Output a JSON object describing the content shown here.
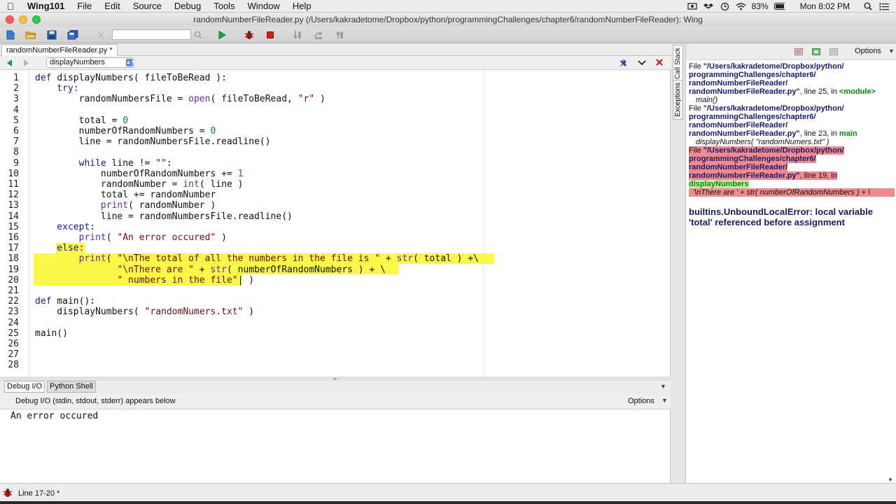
{
  "menubar": {
    "app_name": "Wing101",
    "items": [
      "File",
      "Edit",
      "Source",
      "Debug",
      "Tools",
      "Window",
      "Help"
    ],
    "battery": "83%",
    "clock": "Mon 8:02 PM"
  },
  "window": {
    "title": "randomNumberFileReader.py (/Users/kakradetome/Dropbox/python/programmingChallenges/chapter6/randomNumberFileReader): Wing"
  },
  "editor": {
    "tab_label": "randomNumberFileReader.py *",
    "scope": "displayNumbers",
    "line_numbers": [
      "1",
      "2",
      "3",
      "4",
      "5",
      "6",
      "7",
      "8",
      "9",
      "10",
      "11",
      "12",
      "13",
      "14",
      "15",
      "16",
      "17",
      "18",
      "19",
      "20",
      "21",
      "22",
      "23",
      "24",
      "25",
      "26",
      "27",
      "28"
    ]
  },
  "bottom_panel": {
    "tabs": [
      "Debug I/O",
      "Python Shell"
    ],
    "header": "Debug I/O (stdin, stdout, stderr) appears below",
    "options": "Options",
    "output": "An error occured"
  },
  "stack_panel": {
    "tabs": [
      "Call Stack",
      "Exceptions"
    ],
    "options": "Options",
    "frames": [
      {
        "lines": [
          "\"/Users/kakradetome/Dropbox/python/",
          "programmingChallenges/chapter6/",
          "randomNumberFileReader/",
          "randomNumberFileReader.py\""
        ],
        "prefix": "File ",
        "suffix": ", line 25, in ",
        "func": "<module>",
        "code": "main()"
      },
      {
        "lines": [
          "\"/Users/kakradetome/Dropbox/python/",
          "programmingChallenges/chapter6/",
          "randomNumberFileReader/",
          "randomNumberFileReader.py\""
        ],
        "prefix": "File ",
        "suffix": ", line 23, in ",
        "func": "main",
        "code": "displayNumbers( \"randomNumers.txt\" )"
      },
      {
        "lines": [
          "\"/Users/kakradetome/Dropbox/python/",
          "programmingChallenges/chapter6/",
          "randomNumberFileReader/",
          "randomNumberFileReader.py\""
        ],
        "prefix": "File ",
        "suffix": ", line 19, in",
        "func": "displayNumbers",
        "code": "'\\nThere are ' + str( numberOfRandomNumbers ) + \\"
      }
    ],
    "error": "builtins.UnboundLocalError: local variable\n'total' referenced before assignment"
  },
  "status": {
    "text": "Line 17-20 *"
  }
}
